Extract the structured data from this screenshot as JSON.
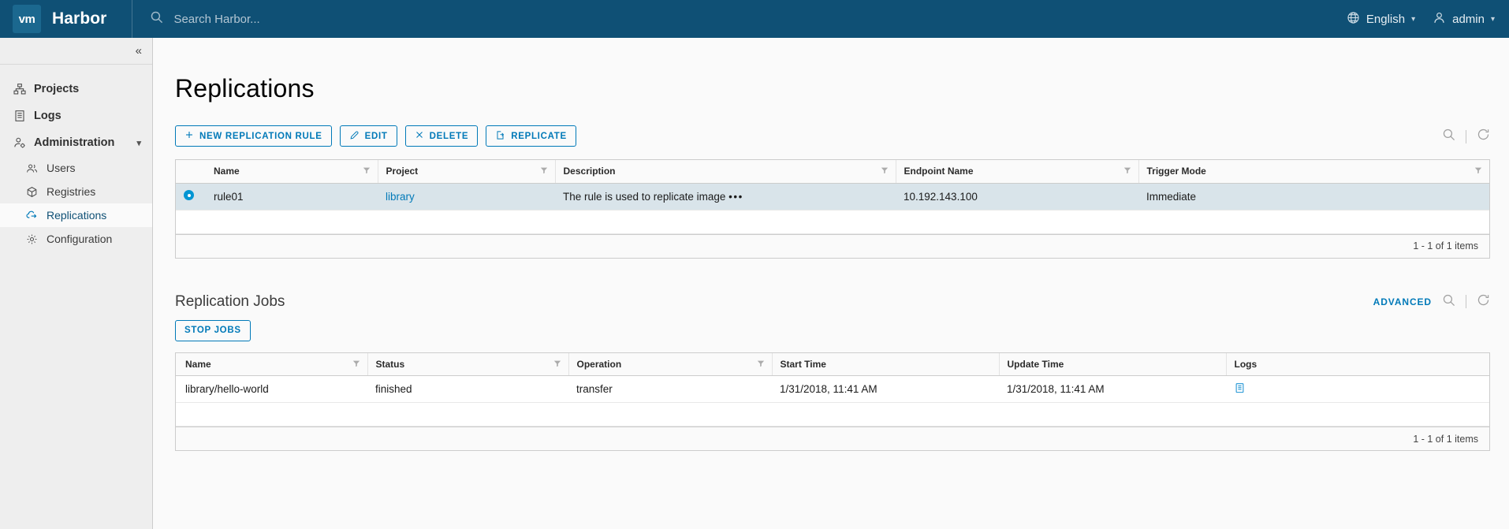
{
  "header": {
    "logo_text": "vm",
    "brand": "Harbor",
    "search_placeholder": "Search Harbor...",
    "search_value": "",
    "language": "English",
    "user": "admin",
    "icons": {
      "search": "search-icon",
      "globe": "globe-icon",
      "user": "user-icon"
    }
  },
  "sidebar": {
    "collapse_label": "«",
    "items": [
      {
        "label": "Projects",
        "icon": "projects-icon",
        "level": "top",
        "active": false,
        "expandable": false
      },
      {
        "label": "Logs",
        "icon": "logs-icon",
        "level": "top",
        "active": false,
        "expandable": false
      },
      {
        "label": "Administration",
        "icon": "administration-icon",
        "level": "top",
        "active": false,
        "expandable": true
      },
      {
        "label": "Users",
        "icon": "users-icon",
        "level": "sub",
        "active": false,
        "expandable": false
      },
      {
        "label": "Registries",
        "icon": "registries-icon",
        "level": "sub",
        "active": false,
        "expandable": false
      },
      {
        "label": "Replications",
        "icon": "replications-icon",
        "level": "sub",
        "active": true,
        "expandable": false
      },
      {
        "label": "Configuration",
        "icon": "configuration-icon",
        "level": "sub",
        "active": false,
        "expandable": false
      }
    ]
  },
  "page": {
    "title": "Replications"
  },
  "toolbar": {
    "new_rule": "NEW REPLICATION RULE",
    "edit": "EDIT",
    "delete": "DELETE",
    "replicate": "REPLICATE"
  },
  "rules_table": {
    "columns": [
      {
        "label": "Name",
        "filter": true
      },
      {
        "label": "Project",
        "filter": true
      },
      {
        "label": "Description",
        "filter": true
      },
      {
        "label": "Endpoint Name",
        "filter": true
      },
      {
        "label": "Trigger Mode",
        "filter": true
      }
    ],
    "rows": [
      {
        "selected": true,
        "name": "rule01",
        "project": "library",
        "description": "The rule is used to replicate image",
        "description_ellipsis": "•••",
        "endpoint_name": "10.192.143.100",
        "trigger_mode": "Immediate"
      }
    ],
    "footer": "1 - 1 of 1 items"
  },
  "jobs": {
    "title": "Replication Jobs",
    "advanced_label": "ADVANCED",
    "stop_jobs": "STOP JOBS",
    "columns": [
      {
        "label": "Name",
        "filter": true
      },
      {
        "label": "Status",
        "filter": true
      },
      {
        "label": "Operation",
        "filter": true
      },
      {
        "label": "Start Time",
        "filter": false
      },
      {
        "label": "Update Time",
        "filter": false
      },
      {
        "label": "Logs",
        "filter": false
      }
    ],
    "rows": [
      {
        "name": "library/hello-world",
        "status": "finished",
        "operation": "transfer",
        "start_time": "1/31/2018, 11:41 AM",
        "update_time": "1/31/2018, 11:41 AM",
        "logs_icon": "log-document-icon"
      }
    ],
    "footer": "1 - 1 of 1 items"
  },
  "colors": {
    "header_bg": "#0f5075",
    "accent": "#0079b8",
    "selected_row": "#d9e4ea",
    "sidebar_bg": "#eeeeee",
    "radio_blue": "#0095d3"
  }
}
